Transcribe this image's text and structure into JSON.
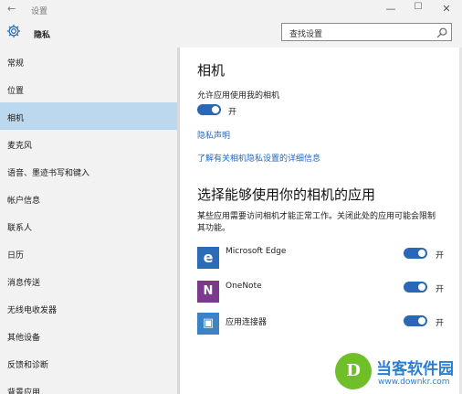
{
  "titlebar": {
    "back_glyph": "←",
    "title": "设置",
    "minimize_glyph": "—",
    "maximize_glyph": "☐",
    "close_glyph": "✕"
  },
  "header": {
    "title": "隐私",
    "icon": "gear-icon"
  },
  "search": {
    "placeholder": "查找设置",
    "icon": "search-icon"
  },
  "sidebar": {
    "items": [
      {
        "label": "常规"
      },
      {
        "label": "位置"
      },
      {
        "label": "相机",
        "selected": true
      },
      {
        "label": "麦克风"
      },
      {
        "label": "语音、墨迹书写和键入"
      },
      {
        "label": "帐户信息"
      },
      {
        "label": "联系人"
      },
      {
        "label": "日历"
      },
      {
        "label": "消息传送"
      },
      {
        "label": "无线电收发器"
      },
      {
        "label": "其他设备"
      },
      {
        "label": "反馈和诊断"
      },
      {
        "label": "背景应用"
      }
    ]
  },
  "main": {
    "title": "相机",
    "allow_label": "允许应用使用我的相机",
    "allow_toggle": {
      "state": true,
      "label": "开"
    },
    "privacy_link": "隐私声明",
    "learn_more_link": "了解有关相机隐私设置的详细信息",
    "apps_title": "选择能够使用你的相机的应用",
    "apps_desc": "某些应用需要访问相机才能正常工作。关闭此处的应用可能会限制其功能。",
    "apps": [
      {
        "name": "Microsoft Edge",
        "icon": "edge-icon",
        "icon_glyph": "e",
        "icon_color": "#2b6bb8",
        "toggle": true,
        "toggle_label": "开"
      },
      {
        "name": "OneNote",
        "icon": "onenote-icon",
        "icon_glyph": "N",
        "icon_color": "#7b3a8e",
        "toggle": true,
        "toggle_label": "开"
      },
      {
        "name": "应用连接器",
        "icon": "app-connector-icon",
        "icon_glyph": "▣",
        "icon_color": "#3b82c6",
        "toggle": true,
        "toggle_label": "开"
      }
    ]
  },
  "colors": {
    "accent": "#2a67b7",
    "selected_bg": "#bcd8ef",
    "sidebar_bg": "#f2f2f2"
  },
  "watermark": {
    "logo_glyph": "D",
    "brand": "当客软件园",
    "url": "www.downkr.com"
  }
}
